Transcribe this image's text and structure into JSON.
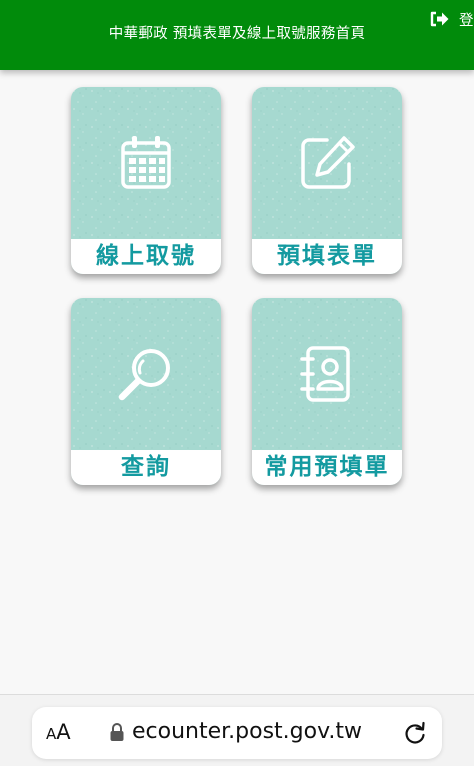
{
  "header": {
    "title": "中華郵政 預填表單及線上取號服務首頁",
    "logout_label": "登",
    "background": "#018b0b"
  },
  "tiles": [
    {
      "label": "線上取號",
      "icon": "calendar-icon"
    },
    {
      "label": "預填表單",
      "icon": "edit-form-icon"
    },
    {
      "label": "查詢",
      "icon": "search-icon"
    },
    {
      "label": "常用預填單",
      "icon": "contacts-book-icon"
    }
  ],
  "colors": {
    "tile_background": "#a6d9d0",
    "tile_label_text": "#139aa0"
  },
  "browser": {
    "text_size_label_small": "A",
    "text_size_label_large": "A",
    "url": "ecounter.post.gov.tw",
    "lock_icon": "lock-icon",
    "reload_icon": "reload-icon"
  }
}
